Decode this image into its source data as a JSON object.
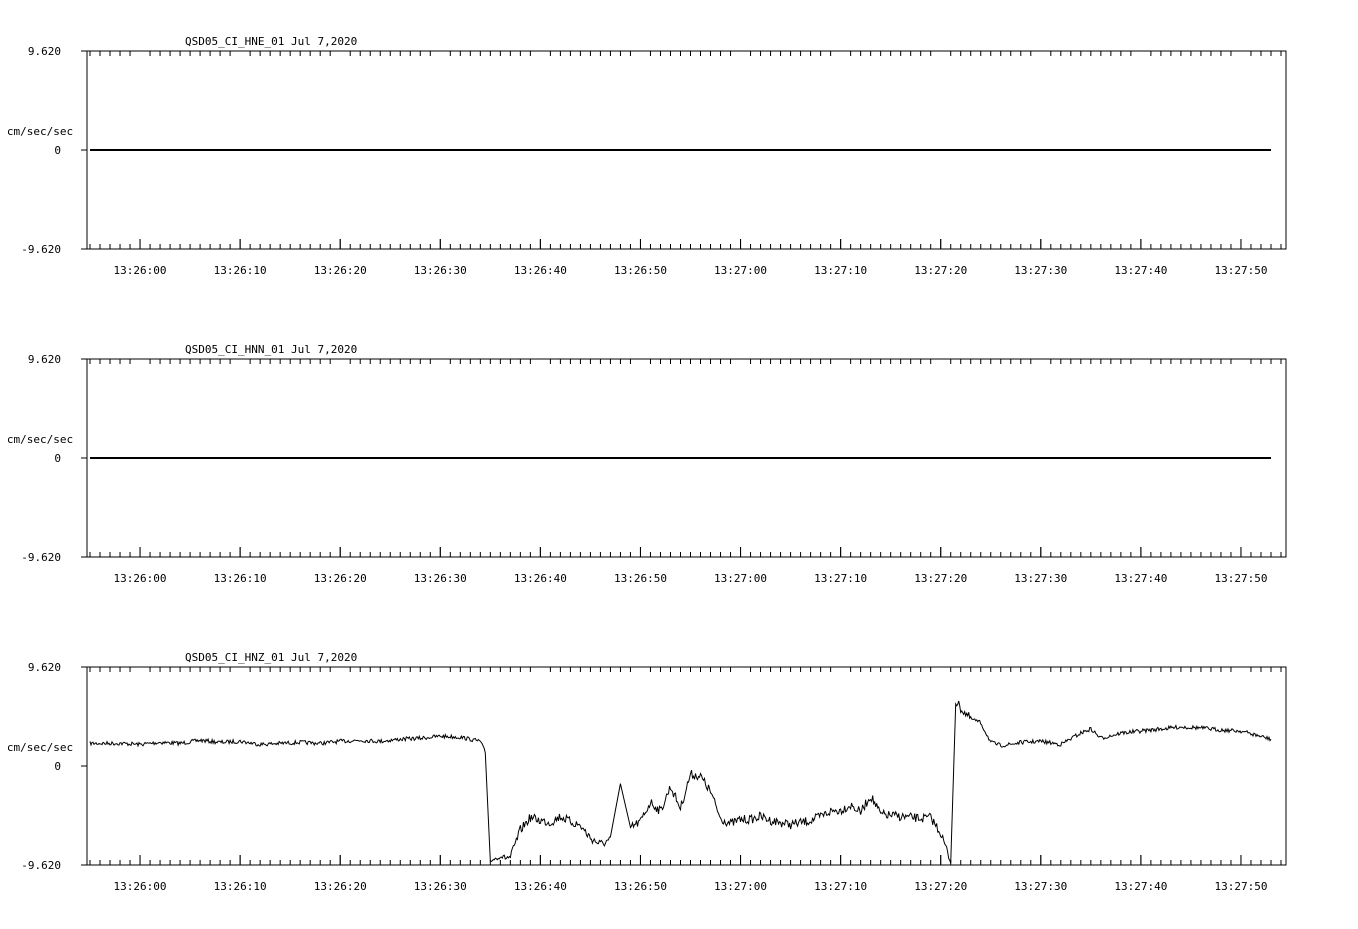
{
  "chart_data": [
    {
      "type": "line",
      "title": "QSD05_CI_HNE_01  Jul 7,2020",
      "ylabel": "cm/sec/sec",
      "ylim": [
        -9.62,
        9.62
      ],
      "y_tick_labels": [
        "9.620",
        "0",
        "-9.620"
      ],
      "x_tick_labels": [
        "13:26:00",
        "13:26:10",
        "13:26:20",
        "13:26:30",
        "13:26:40",
        "13:26:50",
        "13:27:00",
        "13:27:10",
        "13:27:20",
        "13:27:30",
        "13:27:40",
        "13:27:50"
      ],
      "series": [
        {
          "x": [
            "13:25:55",
            "13:27:53"
          ],
          "y": [
            0,
            0
          ]
        }
      ]
    },
    {
      "type": "line",
      "title": "QSD05_CI_HNN_01  Jul 7,2020",
      "ylabel": "cm/sec/sec",
      "ylim": [
        -9.62,
        9.62
      ],
      "y_tick_labels": [
        "9.620",
        "0",
        "-9.620"
      ],
      "x_tick_labels": [
        "13:26:00",
        "13:26:10",
        "13:26:20",
        "13:26:30",
        "13:26:40",
        "13:26:50",
        "13:27:00",
        "13:27:10",
        "13:27:20",
        "13:27:30",
        "13:27:40",
        "13:27:50"
      ],
      "series": [
        {
          "x": [
            "13:25:55",
            "13:27:53"
          ],
          "y": [
            0,
            0
          ]
        }
      ]
    },
    {
      "type": "line",
      "title": "QSD05_CI_HNZ_01  Jul 7,2020",
      "ylabel": "cm/sec/sec",
      "ylim": [
        -9.62,
        9.62
      ],
      "y_tick_labels": [
        "9.620",
        "0",
        "-9.620"
      ],
      "x_tick_labels": [
        "13:26:00",
        "13:26:10",
        "13:26:20",
        "13:26:30",
        "13:26:40",
        "13:26:50",
        "13:27:00",
        "13:27:10",
        "13:27:20",
        "13:27:30",
        "13:27:40",
        "13:27:50"
      ],
      "series": [
        {
          "x": [
            "13:25:55",
            "13:25:58",
            "13:26:00",
            "13:26:02",
            "13:26:04",
            "13:26:06",
            "13:26:08",
            "13:26:10",
            "13:26:12",
            "13:26:14",
            "13:26:16",
            "13:26:18",
            "13:26:20",
            "13:26:22",
            "13:26:24",
            "13:26:26",
            "13:26:28",
            "13:26:30",
            "13:26:32",
            "13:26:34",
            "13:26:34.5",
            "13:26:35",
            "13:26:36",
            "13:26:37",
            "13:26:38",
            "13:26:39",
            "13:26:40",
            "13:26:41",
            "13:26:42",
            "13:26:43",
            "13:26:44",
            "13:26:45",
            "13:26:46",
            "13:26:47",
            "13:26:48",
            "13:26:49",
            "13:26:50",
            "13:26:51",
            "13:26:52",
            "13:26:53",
            "13:26:54",
            "13:26:55",
            "13:26:56",
            "13:26:57",
            "13:26:58",
            "13:26:59",
            "13:27:00",
            "13:27:01",
            "13:27:02",
            "13:27:03",
            "13:27:04",
            "13:27:05",
            "13:27:06",
            "13:27:07",
            "13:27:08",
            "13:27:09",
            "13:27:10",
            "13:27:11",
            "13:27:12",
            "13:27:13",
            "13:27:14",
            "13:27:15",
            "13:27:16",
            "13:27:17",
            "13:27:18",
            "13:27:19",
            "13:27:20",
            "13:27:21",
            "13:27:21.5",
            "13:27:22",
            "13:27:23",
            "13:27:24",
            "13:27:25",
            "13:27:26",
            "13:27:27",
            "13:27:28",
            "13:27:30",
            "13:27:32",
            "13:27:34",
            "13:27:35",
            "13:27:36",
            "13:27:38",
            "13:27:40",
            "13:27:42",
            "13:27:44",
            "13:27:46",
            "13:27:48",
            "13:27:50",
            "13:27:53"
          ],
          "y": [
            2.2,
            2.2,
            2.1,
            2.3,
            2.2,
            2.5,
            2.3,
            2.4,
            2.1,
            2.2,
            2.3,
            2.2,
            2.4,
            2.5,
            2.4,
            2.6,
            2.7,
            2.9,
            2.8,
            2.4,
            1.3,
            -9.2,
            -8.8,
            -8.9,
            -6.2,
            -5.0,
            -5.3,
            -5.5,
            -4.9,
            -5.4,
            -5.8,
            -7.0,
            -7.6,
            -7.2,
            -2.1,
            -6.0,
            -5.4,
            -3.5,
            -4.4,
            -2.0,
            -4.1,
            -0.8,
            -1.0,
            -2.5,
            -5.1,
            -5.6,
            -5.2,
            -5.2,
            -4.9,
            -5.3,
            -5.5,
            -5.7,
            -5.5,
            -5.3,
            -4.9,
            -4.4,
            -4.3,
            -3.8,
            -4.5,
            -2.9,
            -4.7,
            -4.8,
            -4.9,
            -5.0,
            -5.1,
            -5.0,
            -6.5,
            -9.3,
            6.3,
            5.6,
            4.6,
            4.2,
            2.3,
            2.0,
            2.1,
            2.3,
            2.4,
            2.1,
            3.2,
            3.6,
            2.7,
            3.2,
            3.4,
            3.6,
            3.8,
            3.7,
            3.5,
            3.4,
            2.6
          ]
        }
      ]
    }
  ]
}
